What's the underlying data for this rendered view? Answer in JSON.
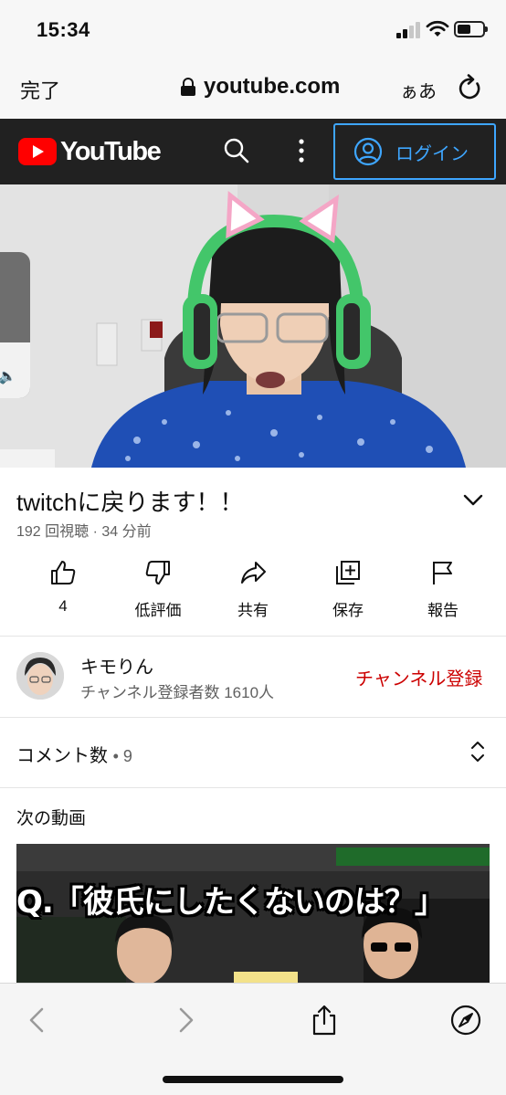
{
  "status_bar": {
    "time": "15:34"
  },
  "browser": {
    "done_label": "完了",
    "url": "youtube.com",
    "text_size_label": "ぁあ"
  },
  "youtube_header": {
    "logo_text": "YouTube",
    "login_label": "ログイン"
  },
  "video": {
    "title": "twitchに戻ります！！",
    "meta": "192 回視聴 · 34 分前",
    "volume_level": 0.38
  },
  "actions": [
    {
      "icon": "thumbs-up-icon",
      "label": "4"
    },
    {
      "icon": "thumbs-down-icon",
      "label": "低評価"
    },
    {
      "icon": "share-icon",
      "label": "共有"
    },
    {
      "icon": "add-to-playlist-icon",
      "label": "保存"
    },
    {
      "icon": "flag-icon",
      "label": "報告"
    }
  ],
  "channel": {
    "name": "キモりん",
    "subscribers": "チャンネル登録者数 1610人",
    "subscribe_label": "チャンネル登録"
  },
  "comments": {
    "label": "コメント数",
    "count": "9"
  },
  "up_next": {
    "label": "次の動画",
    "thumbnail_caption": "Q.「彼氏にしたくないのは？」"
  },
  "colors": {
    "youtube_red": "#ff0000",
    "header_bg": "#212121",
    "login_blue": "#3ea6ff",
    "subscribe_red": "#cc0000"
  }
}
